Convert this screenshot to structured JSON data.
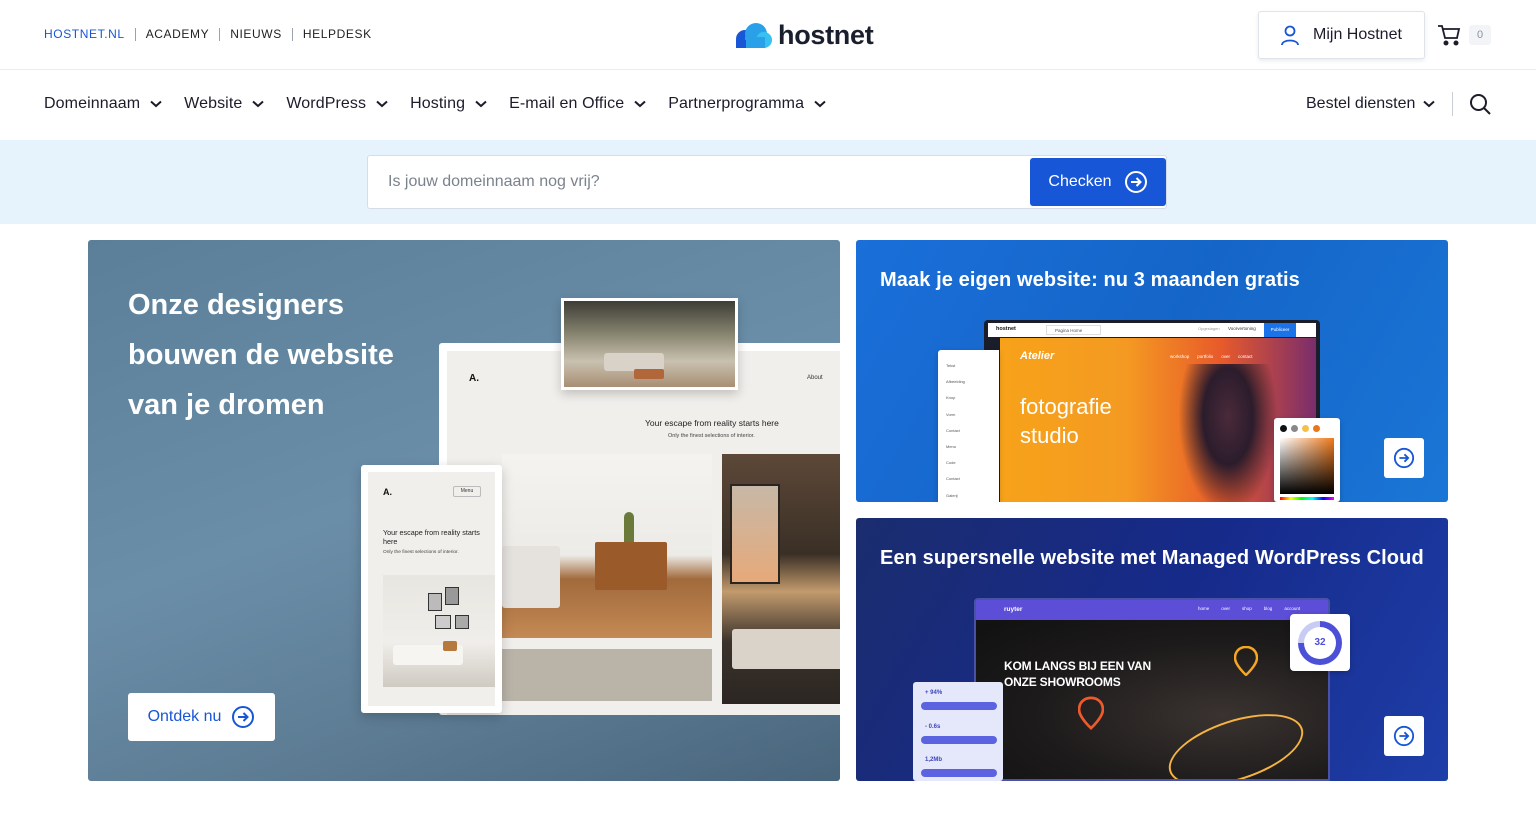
{
  "toplinks": [
    "HOSTNET.NL",
    "ACADEMY",
    "NIEUWS",
    "HELPDESK"
  ],
  "logo": {
    "text": "hostnet"
  },
  "account": {
    "label": "Mijn Hostnet"
  },
  "cart": {
    "count": "0"
  },
  "nav": {
    "items": [
      "Domeinnaam",
      "Website",
      "WordPress",
      "Hosting",
      "E-mail en Office",
      "Partnerprogramma"
    ],
    "order_label": "Bestel diensten"
  },
  "domain_search": {
    "placeholder": "Is jouw domeinnaam nog vrij?",
    "button_label": "Checken"
  },
  "hero": {
    "title": "Onze designers bouwen de website van je dromen",
    "button_label": "Ontdek nu",
    "mockup": {
      "logo": "A.",
      "nav_about": "About",
      "tagline": "Your escape from reality starts here",
      "subline": "Only the finest selections of interior.",
      "mobile_menu": "Menu",
      "mobile_tagline": "Your escape from reality starts here",
      "mobile_subline": "Only the finest selections of interior."
    }
  },
  "promo_cards": [
    {
      "title": "Maak je eigen website: nu 3 maanden gratis",
      "mockup": {
        "brand": "hostnet",
        "page_selector": "Pagina Home",
        "btn_preview": "Opgeslagen",
        "btn_preview2": "Voorvertoning",
        "btn_publish": "Publiceer",
        "site_name": "Atelier",
        "site_nav": [
          "workshop",
          "portfolio",
          "over",
          "contact"
        ],
        "headline_1": "fotografie",
        "headline_2": "studio",
        "sidebar": [
          "Tekst",
          "Afbeelding",
          "Knop",
          "Vorm",
          "Contact",
          "Menu",
          "Code",
          "Contact",
          "Galerij"
        ]
      }
    },
    {
      "title": "Een supersnelle website met Managed WordPress Cloud",
      "mockup": {
        "brand": "ruyter",
        "site_nav": [
          "home",
          "over",
          "shop",
          "blog",
          "account"
        ],
        "headline_1": "KOM LANGS BIJ EEN VAN",
        "headline_2": "ONZE SHOWROOMS",
        "score": "32",
        "stats": [
          "+ 94%",
          "- 0.6s",
          "1,2Mb"
        ]
      }
    }
  ],
  "colors": {
    "brand_blue": "#1756d6",
    "band_bg": "#e6f2fc"
  }
}
